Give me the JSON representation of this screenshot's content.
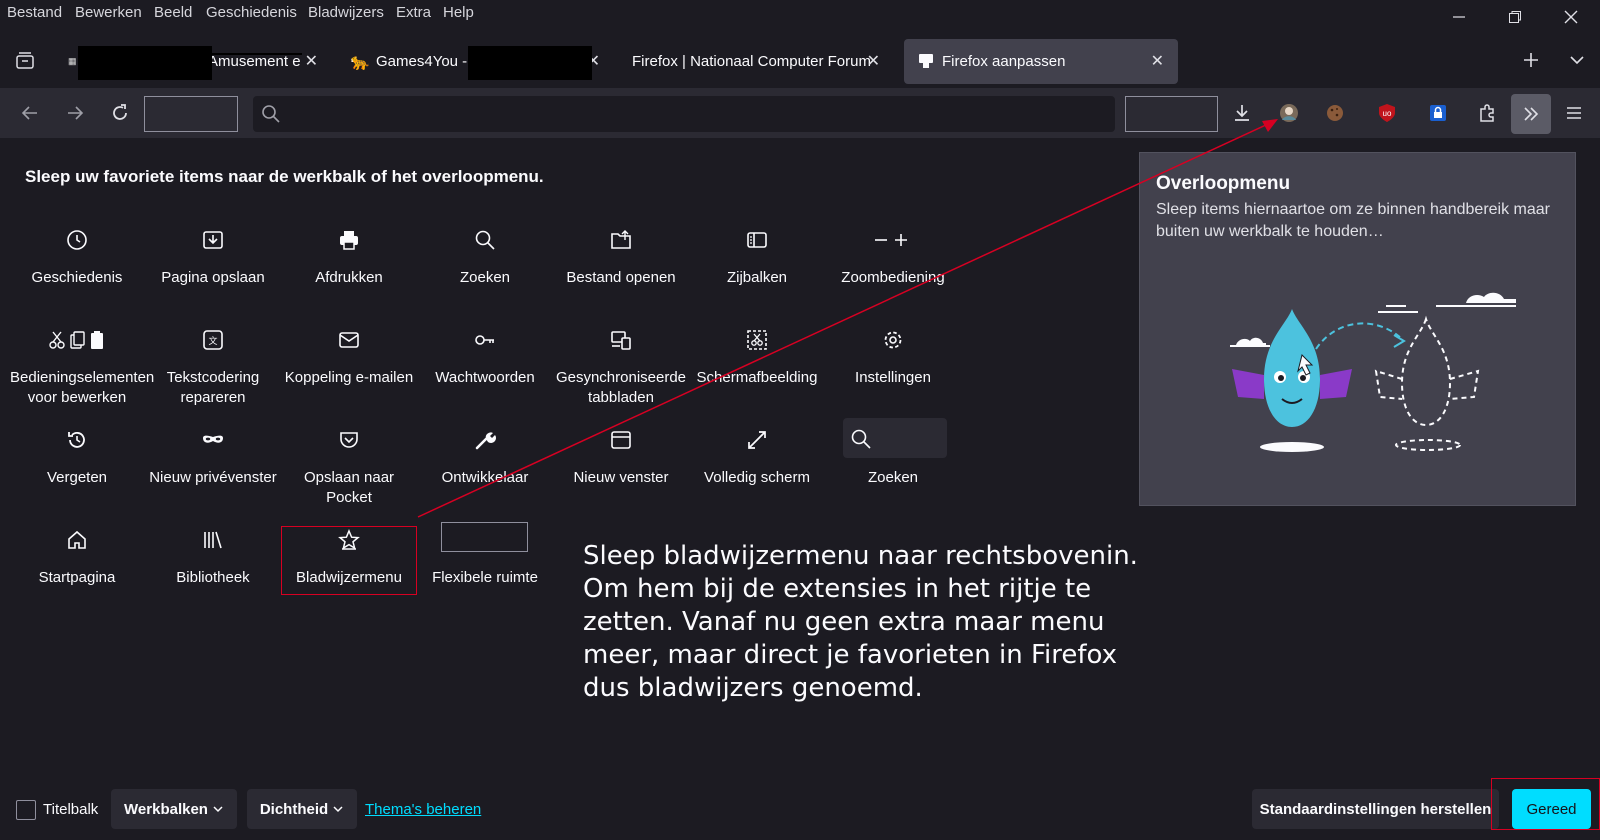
{
  "menubar": [
    "Bestand",
    "Bewerken",
    "Beeld",
    "Geschiedenis",
    "Bladwijzers",
    "Extra",
    "Help"
  ],
  "tabs": [
    {
      "title": "Amusement e",
      "active": false
    },
    {
      "title": "Games4You -",
      "active": false
    },
    {
      "title": "Firefox | Nationaal Computer Forum",
      "active": false
    },
    {
      "title": "Firefox aanpassen",
      "active": true
    }
  ],
  "heading": "Sleep uw favoriete items naar de werkbalk of het overloopmenu.",
  "palette": [
    {
      "label": "Geschiedenis",
      "icon": "clock-icon"
    },
    {
      "label": "Pagina opslaan",
      "icon": "save-page-icon"
    },
    {
      "label": "Afdrukken",
      "icon": "printer-icon"
    },
    {
      "label": "Zoeken",
      "icon": "search-icon"
    },
    {
      "label": "Bestand openen",
      "icon": "open-file-icon"
    },
    {
      "label": "Zijbalken",
      "icon": "sidebar-icon"
    },
    {
      "label": "Zoombediening",
      "icon": "zoom-icon"
    },
    {
      "label": "Bedieningselementen voor bewerken",
      "icon": "edit-controls-icon"
    },
    {
      "label": "Tekstcodering repareren",
      "icon": "text-encoding-icon"
    },
    {
      "label": "Koppeling e-mailen",
      "icon": "mail-icon"
    },
    {
      "label": "Wachtwoorden",
      "icon": "key-icon"
    },
    {
      "label": "Gesynchroniseerde tabbladen",
      "icon": "synced-tabs-icon"
    },
    {
      "label": "Schermafbeelding",
      "icon": "screenshot-icon"
    },
    {
      "label": "Instellingen",
      "icon": "gear-icon"
    },
    {
      "label": "Vergeten",
      "icon": "forget-icon"
    },
    {
      "label": "Nieuw privévenster",
      "icon": "private-mask-icon"
    },
    {
      "label": "Opslaan naar Pocket",
      "icon": "pocket-icon"
    },
    {
      "label": "Ontwikkelaar",
      "icon": "wrench-icon"
    },
    {
      "label": "Nieuw venster",
      "icon": "new-window-icon"
    },
    {
      "label": "Volledig scherm",
      "icon": "fullscreen-icon"
    },
    {
      "label": "Zoeken",
      "icon": "search-box-icon"
    },
    {
      "label": "Startpagina",
      "icon": "home-icon"
    },
    {
      "label": "Bibliotheek",
      "icon": "library-icon"
    },
    {
      "label": "Bladwijzermenu",
      "icon": "bookmark-star-icon"
    },
    {
      "label": "Flexibele ruimte",
      "icon": "flexible-space-icon"
    }
  ],
  "overflow_panel": {
    "title": "Overloopmenu",
    "description": "Sleep items hiernaartoe om ze binnen handbereik maar buiten uw werkbalk te houden…"
  },
  "annotation": "Sleep bladwijzermenu naar rechtsbovenin. Om hem bij de extensies in het rijtje te zetten. Vanaf nu geen extra maar menu meer, maar direct je favorieten in Firefox dus bladwijzers genoemd.",
  "bottom": {
    "titlebar_label": "Titelbalk",
    "toolbars_label": "Werkbalken",
    "density_label": "Dichtheid",
    "themes_link": "Thema's beheren",
    "restore_label": "Standaardinstellingen herstellen",
    "done_label": "Gereed"
  },
  "colors": {
    "accent": "#00ddff",
    "highlight": "#d70022",
    "background": "#1c1b22",
    "toolbar": "#2b2a33"
  }
}
